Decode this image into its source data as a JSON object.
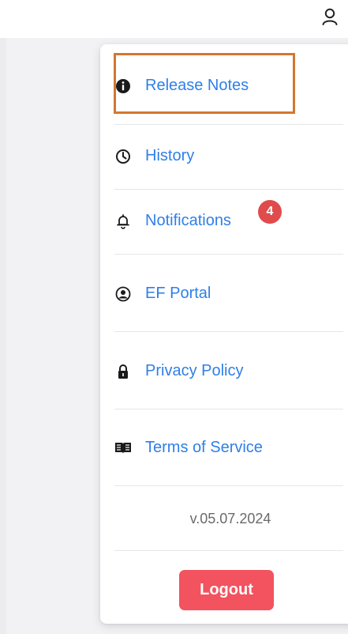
{
  "menu": {
    "items": [
      {
        "label": "Release Notes",
        "icon": "info-circle-icon"
      },
      {
        "label": "History",
        "icon": "clock-icon"
      },
      {
        "label": "Notifications",
        "icon": "bell-icon",
        "badge": "4"
      },
      {
        "label": "EF Portal",
        "icon": "user-circle-icon"
      },
      {
        "label": "Privacy Policy",
        "icon": "lock-icon"
      },
      {
        "label": "Terms of Service",
        "icon": "book-icon"
      }
    ],
    "version": "v.05.07.2024",
    "logout_label": "Logout"
  },
  "colors": {
    "link": "#2f7fe8",
    "logout": "#f3525f",
    "badge": "#e04b4b",
    "highlight": "#d3772f",
    "background": "#f2f2f4"
  }
}
